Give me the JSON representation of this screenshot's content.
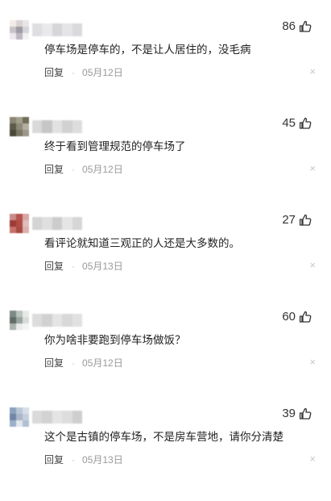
{
  "comments": [
    {
      "text": "停车场是停车的，不是让人居住的，没毛病",
      "likes": "86",
      "reply_label": "回复",
      "separator": "·",
      "date": "05月12日",
      "close_glyph": "×",
      "avatar_colors": [
        "#f1ece9",
        "#d8d2d0",
        "#e9e5e6",
        "#c8c3c8",
        "#9e9aa3",
        "#d6d3da",
        "#ece9ee",
        "#bdb7c1",
        "#f3f1f3"
      ],
      "name_colors": [
        "#d9d9dc",
        "#e6e6e8",
        "#cfd0d3",
        "#e0e0e3",
        "#d4d4d6"
      ]
    },
    {
      "text": "终于看到管理规范的停车场了",
      "likes": "45",
      "reply_label": "回复",
      "separator": "·",
      "date": "05月12日",
      "close_glyph": "×",
      "avatar_colors": [
        "#8b8673",
        "#a3a08a",
        "#6f6c5a",
        "#5d5a49",
        "#8c8a79",
        "#b3b09f",
        "#4b4838",
        "#7a7663",
        "#9b978a"
      ],
      "name_colors": [
        "#d3d3d3",
        "#bdbdbd",
        "#dedede",
        "#cacaca",
        "#d8d8d8"
      ]
    },
    {
      "text": "看评论就知道三观正的人还是大多数的。",
      "likes": "27",
      "reply_label": "回复",
      "separator": "·",
      "date": "05月13日",
      "close_glyph": "×",
      "avatar_colors": [
        "#c98a88",
        "#b5534e",
        "#d8a6a3",
        "#9e3a36",
        "#b34b45",
        "#e0bdbb",
        "#c7716c",
        "#a84a44",
        "#dcb0ad"
      ],
      "name_colors": [
        "#cdcdcd",
        "#dadada",
        "#c4c4c4",
        "#e1e1e1",
        "#d0d0d0"
      ]
    },
    {
      "text": "你为啥非要跑到停车场做饭？",
      "likes": "60",
      "reply_label": "回复",
      "separator": "·",
      "date": "05月12日",
      "close_glyph": "×",
      "avatar_colors": [
        "#7d8a83",
        "#b9c2bd",
        "#e6e9e7",
        "#5f6d66",
        "#9aa49f",
        "#d7dcd9",
        "#aab3ae",
        "#e9ecea",
        "#f3f5f4"
      ],
      "name_colors": [
        "#d6d6d6",
        "#c9c9c9",
        "#e0e0e0",
        "#d2d2d2",
        "#dcdcdc"
      ]
    },
    {
      "text": "这个是古镇的停车场，不是房车营地，请你分清楚",
      "likes": "39",
      "reply_label": "回复",
      "separator": "·",
      "date": "05月13日",
      "close_glyph": "×",
      "avatar_colors": [
        "#8aa2bf",
        "#b9c7d6",
        "#d7dee6",
        "#6f87a6",
        "#a9b7c8",
        "#c5cfdb",
        "#9bb0c8",
        "#e2e7ed",
        "#b0bfd0"
      ],
      "name_colors": [
        "#d4d4d4",
        "#cbcbcb",
        "#e0e0e0",
        "#d8d8d8",
        "#c6c6c6"
      ]
    }
  ]
}
